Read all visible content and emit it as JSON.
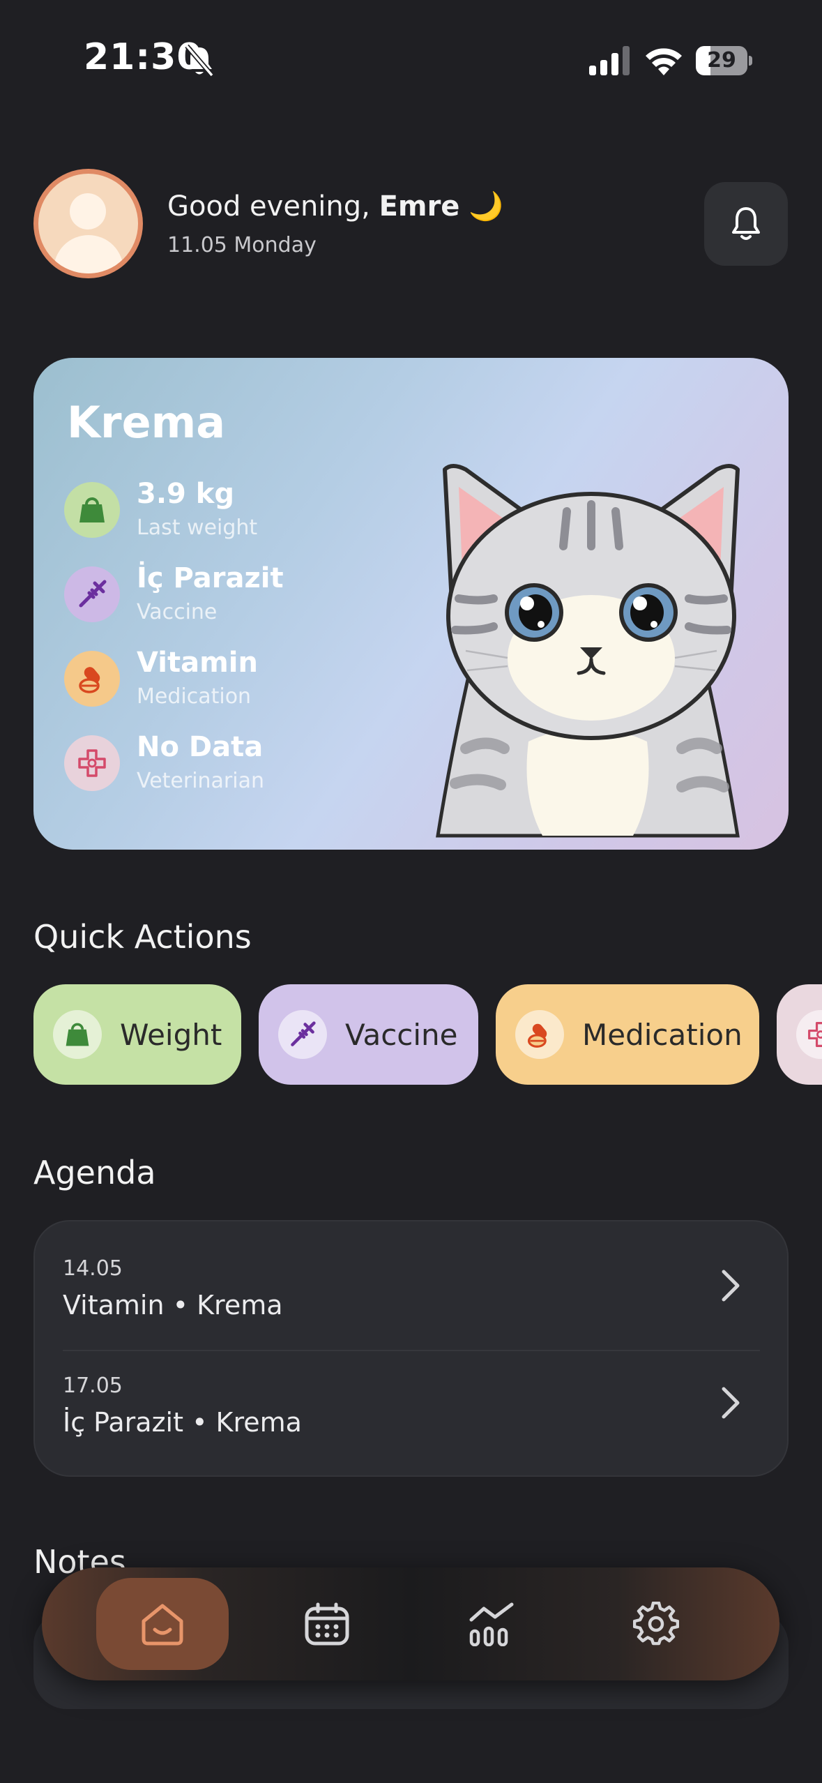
{
  "status_bar": {
    "time": "21:30",
    "battery": "29",
    "battery_level": 0.29
  },
  "header": {
    "greeting": "Good evening, ",
    "user_name": "Emre",
    "greeting_emoji": "🌙",
    "date": "11.05 Monday"
  },
  "pet_card": {
    "name": "Krema",
    "stats": [
      {
        "value": "3.9 kg",
        "label": "Last weight",
        "icon": "scale-icon",
        "color": "#c3dfa5"
      },
      {
        "value": "İç Parazit",
        "label": "Vaccine",
        "icon": "syringe-icon",
        "color": "#cdb9e6"
      },
      {
        "value": "Vitamin",
        "label": "Medication",
        "icon": "pills-icon",
        "color": "#f5c98a"
      },
      {
        "value": "No Data",
        "label": "Veterinarian",
        "icon": "vet-cross-icon",
        "color": "#e8d2db"
      }
    ]
  },
  "quick_actions": {
    "title": "Quick Actions",
    "items": [
      {
        "label": "Weight",
        "color": "#c5e1a5",
        "icon": "scale-icon"
      },
      {
        "label": "Vaccine",
        "color": "#d1c3ea",
        "icon": "syringe-icon"
      },
      {
        "label": "Medication",
        "color": "#f7cf8c",
        "icon": "pills-icon"
      },
      {
        "label": "",
        "color": "#ead8df",
        "icon": "vet-cross-icon"
      }
    ]
  },
  "agenda": {
    "title": "Agenda",
    "items": [
      {
        "date": "14.05",
        "title": "Vitamin • Krema"
      },
      {
        "date": "17.05",
        "title": "İç Parazit • Krema"
      }
    ]
  },
  "notes": {
    "title": "Notes"
  },
  "bottom_nav": {
    "items": [
      "home-icon",
      "calendar-icon",
      "chart-icon",
      "settings-icon"
    ],
    "active": "home-icon",
    "accent": "#e8956a"
  }
}
